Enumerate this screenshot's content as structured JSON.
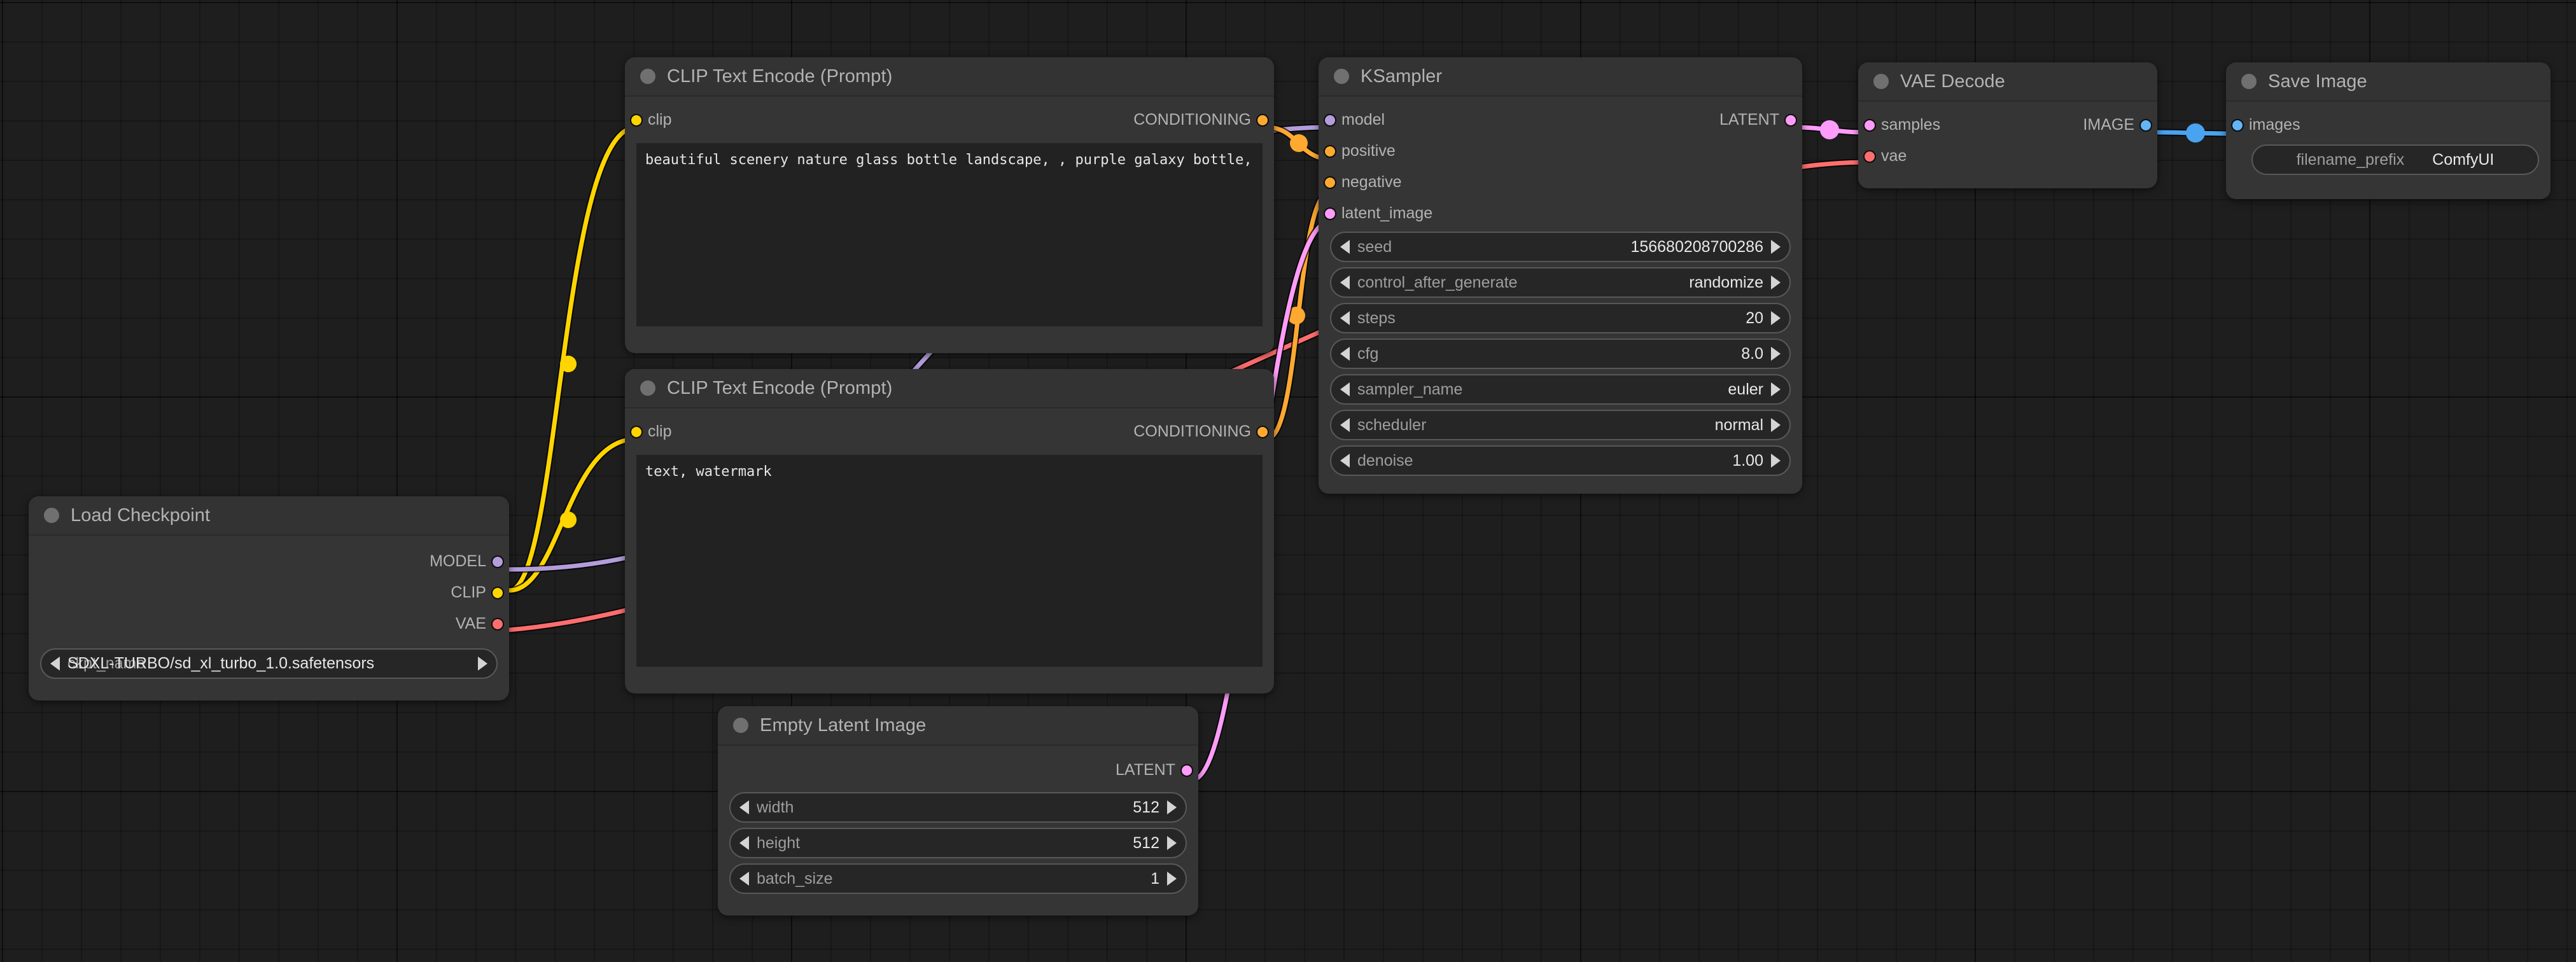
{
  "app": {
    "name": "ComfyUI",
    "canvas_background": "#1e1e1e"
  },
  "slot_colors": {
    "MODEL": "#b39ddb",
    "CLIP": "#FFD500",
    "VAE": "#FF6E6E",
    "CONDITIONING": "#FFA931",
    "LATENT": "#FF9CF9",
    "IMAGE": "#64B5F6"
  },
  "nodes": [
    {
      "id": "load-checkpoint",
      "title": "Load Checkpoint",
      "outputs": [
        {
          "label": "MODEL",
          "type": "MODEL"
        },
        {
          "label": "CLIP",
          "type": "CLIP"
        },
        {
          "label": "VAE",
          "type": "VAE"
        }
      ],
      "widgets": [
        {
          "name": "ckpt_name",
          "value": "SDXL-TURBO/sd_xl_turbo_1.0.safetensors"
        }
      ]
    },
    {
      "id": "clip-positive",
      "title": "CLIP Text Encode (Prompt)",
      "inputs": [
        {
          "label": "clip",
          "type": "CLIP"
        }
      ],
      "outputs": [
        {
          "label": "CONDITIONING",
          "type": "CONDITIONING"
        }
      ],
      "text": "beautiful scenery nature glass bottle landscape, , purple galaxy bottle,"
    },
    {
      "id": "clip-negative",
      "title": "CLIP Text Encode (Prompt)",
      "inputs": [
        {
          "label": "clip",
          "type": "CLIP"
        }
      ],
      "outputs": [
        {
          "label": "CONDITIONING",
          "type": "CONDITIONING"
        }
      ],
      "text": "text, watermark"
    },
    {
      "id": "ksampler",
      "title": "KSampler",
      "inputs": [
        {
          "label": "model",
          "type": "MODEL"
        },
        {
          "label": "positive",
          "type": "CONDITIONING"
        },
        {
          "label": "negative",
          "type": "CONDITIONING"
        },
        {
          "label": "latent_image",
          "type": "LATENT"
        }
      ],
      "outputs": [
        {
          "label": "LATENT",
          "type": "LATENT"
        }
      ],
      "widgets": [
        {
          "name": "seed",
          "value": "156680208700286"
        },
        {
          "name": "control_after_generate",
          "value": "randomize"
        },
        {
          "name": "steps",
          "value": "20"
        },
        {
          "name": "cfg",
          "value": "8.0"
        },
        {
          "name": "sampler_name",
          "value": "euler"
        },
        {
          "name": "scheduler",
          "value": "normal"
        },
        {
          "name": "denoise",
          "value": "1.00"
        }
      ]
    },
    {
      "id": "empty-latent",
      "title": "Empty Latent Image",
      "outputs": [
        {
          "label": "LATENT",
          "type": "LATENT"
        }
      ],
      "widgets": [
        {
          "name": "width",
          "value": "512"
        },
        {
          "name": "height",
          "value": "512"
        },
        {
          "name": "batch_size",
          "value": "1"
        }
      ]
    },
    {
      "id": "vae-decode",
      "title": "VAE Decode",
      "inputs": [
        {
          "label": "samples",
          "type": "LATENT"
        },
        {
          "label": "vae",
          "type": "VAE"
        }
      ],
      "outputs": [
        {
          "label": "IMAGE",
          "type": "IMAGE"
        }
      ]
    },
    {
      "id": "save-image",
      "title": "Save Image",
      "inputs": [
        {
          "label": "images",
          "type": "IMAGE"
        }
      ],
      "widgets": [
        {
          "name": "filename_prefix",
          "value": "ComfyUI"
        }
      ]
    }
  ]
}
